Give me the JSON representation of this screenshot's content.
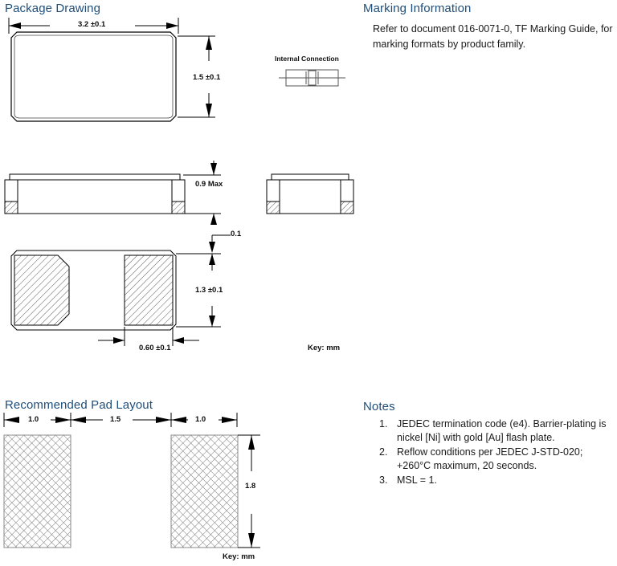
{
  "sections": {
    "package_drawing": {
      "title": "Package Drawing"
    },
    "marking_information": {
      "title": "Marking Information",
      "paragraph": "Refer to document 016-0071-0, TF Marking Guide, for marking formats by product family."
    },
    "recommended_pad_layout": {
      "title": "Recommended Pad Layout"
    },
    "notes": {
      "title": "Notes",
      "items": [
        "JEDEC termination code (e4).  Barrier-plating is nickel [Ni] with gold [Au] flash plate.",
        "Reflow conditions per JEDEC J-STD-020; +260°C maximum, 20 seconds.",
        "MSL = 1."
      ]
    }
  },
  "package_drawing": {
    "top_view": {
      "width_dim": "3.2 ±0.1",
      "height_dim": "1.5 ±0.1"
    },
    "front_view": {
      "height_dim": "0.9 Max"
    },
    "bottom_view": {
      "standoff_dim": "0.1",
      "height_dim": "1.3 ±0.1",
      "pad_width_dim": "0.60 ±0.1"
    },
    "internal_connection": {
      "label": "Internal Connection"
    },
    "key": "Key:  mm"
  },
  "pad_layout": {
    "dim_left": "1.0",
    "dim_center": "1.5",
    "dim_right": "1.0",
    "dim_height": "1.8",
    "key": "Key:  mm"
  },
  "colors": {
    "heading": "#1f4e79",
    "line": "#000000",
    "hatch": "#555555",
    "text": "#1a1a1a"
  }
}
